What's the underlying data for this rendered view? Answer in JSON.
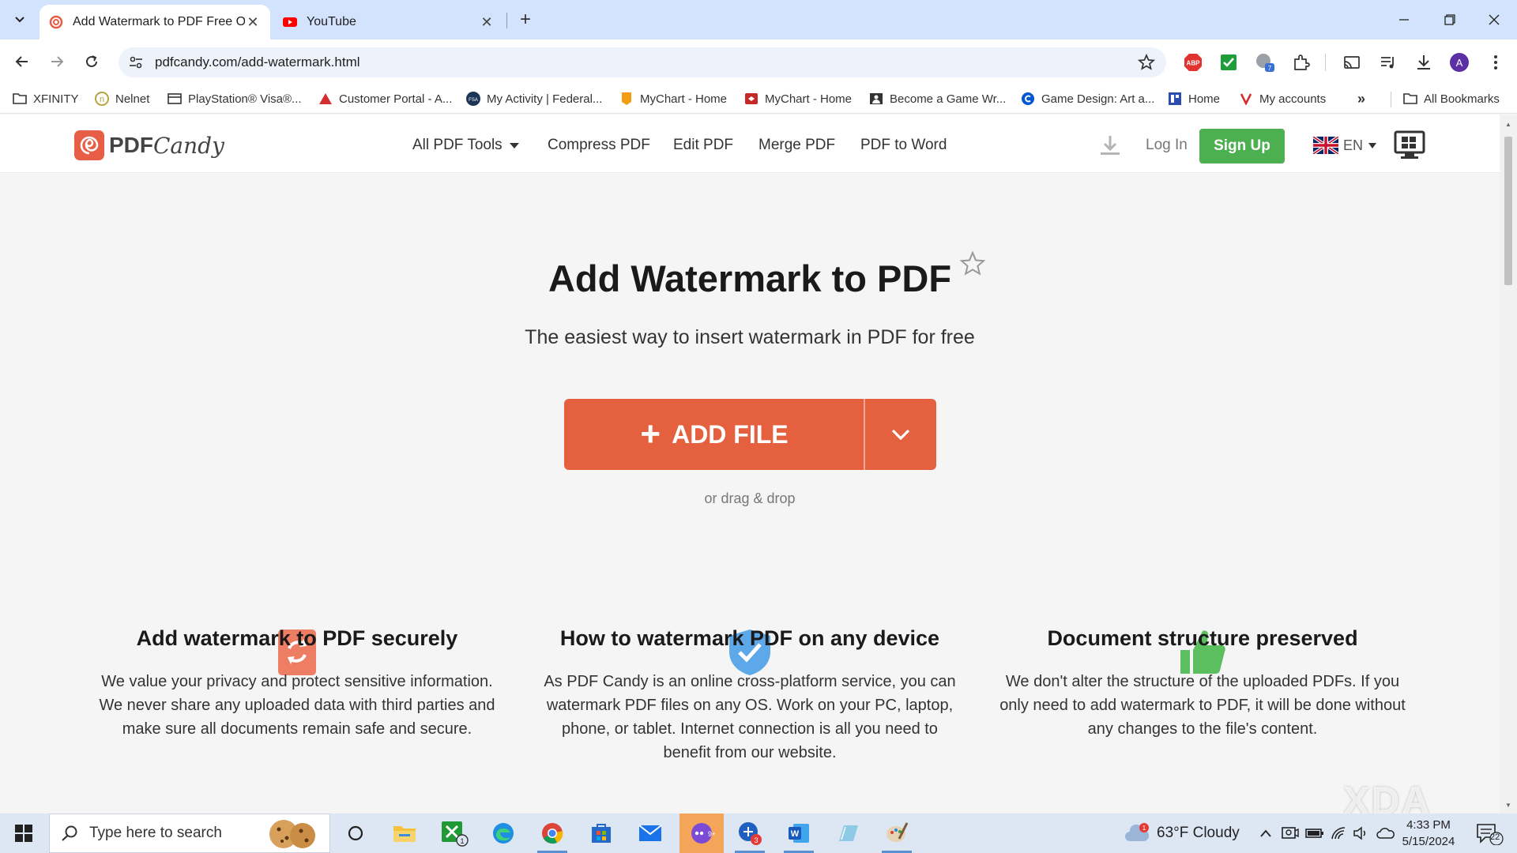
{
  "browser": {
    "tabs": [
      {
        "title": "Add Watermark to PDF Free On",
        "active": true
      },
      {
        "title": "YouTube",
        "active": false
      }
    ],
    "url": "pdfcandy.com/add-watermark.html",
    "profile_initial": "A",
    "bookmarks": [
      {
        "label": "XFINITY",
        "icon": "folder-icon"
      },
      {
        "label": "Nelnet",
        "icon": "nelnet-icon"
      },
      {
        "label": "PlayStation® Visa®...",
        "icon": "card-icon"
      },
      {
        "label": "Customer Portal - A...",
        "icon": "portal-icon"
      },
      {
        "label": "My Activity | Federal...",
        "icon": "fsa-icon"
      },
      {
        "label": "MyChart - Home",
        "icon": "mychart-icon"
      },
      {
        "label": "MyChart - Home",
        "icon": "mychart-icon"
      },
      {
        "label": "Become a Game Wr...",
        "icon": "person-icon"
      },
      {
        "label": "Game Design: Art a...",
        "icon": "coursera-icon"
      },
      {
        "label": "Home",
        "icon": "home-grid-icon"
      },
      {
        "label": "My accounts",
        "icon": "v-icon"
      }
    ],
    "all_bookmarks": "All Bookmarks"
  },
  "site": {
    "logo_pdf": "PDF",
    "logo_candy": "Candy",
    "nav": [
      "All PDF Tools",
      "Compress PDF",
      "Edit PDF",
      "Merge PDF",
      "PDF to Word"
    ],
    "login": "Log In",
    "signup": "Sign Up",
    "lang": "EN"
  },
  "hero": {
    "title": "Add Watermark to PDF",
    "subtitle": "The easiest way to insert watermark in PDF for free",
    "add_file": "ADD FILE",
    "drag": "or drag & drop"
  },
  "features": [
    {
      "title": "Add watermark to PDF securely",
      "text": "We value your privacy and protect sensitive information. We never share any uploaded data with third parties and make sure all documents remain safe and secure."
    },
    {
      "title": "How to watermark PDF on any device",
      "text": "As PDF Candy is an online cross-platform service, you can watermark PDF files on any OS. Work on your PC, laptop, phone, or tablet. Internet connection is all you need to benefit from our website."
    },
    {
      "title": "Document structure preserved",
      "text": "We don't alter the structure of the uploaded PDFs. If you only need to add watermark to PDF, it will be done without any changes to the file's content."
    }
  ],
  "watermark": "XDA",
  "taskbar": {
    "search_placeholder": "Type here to search",
    "weather": "63°F  Cloudy",
    "time": "4:33 PM",
    "date": "5/15/2024",
    "notifications": "22"
  },
  "colors": {
    "accent": "#e5603f",
    "signup": "#4caf50",
    "tabstrip": "#d3e3fd"
  }
}
